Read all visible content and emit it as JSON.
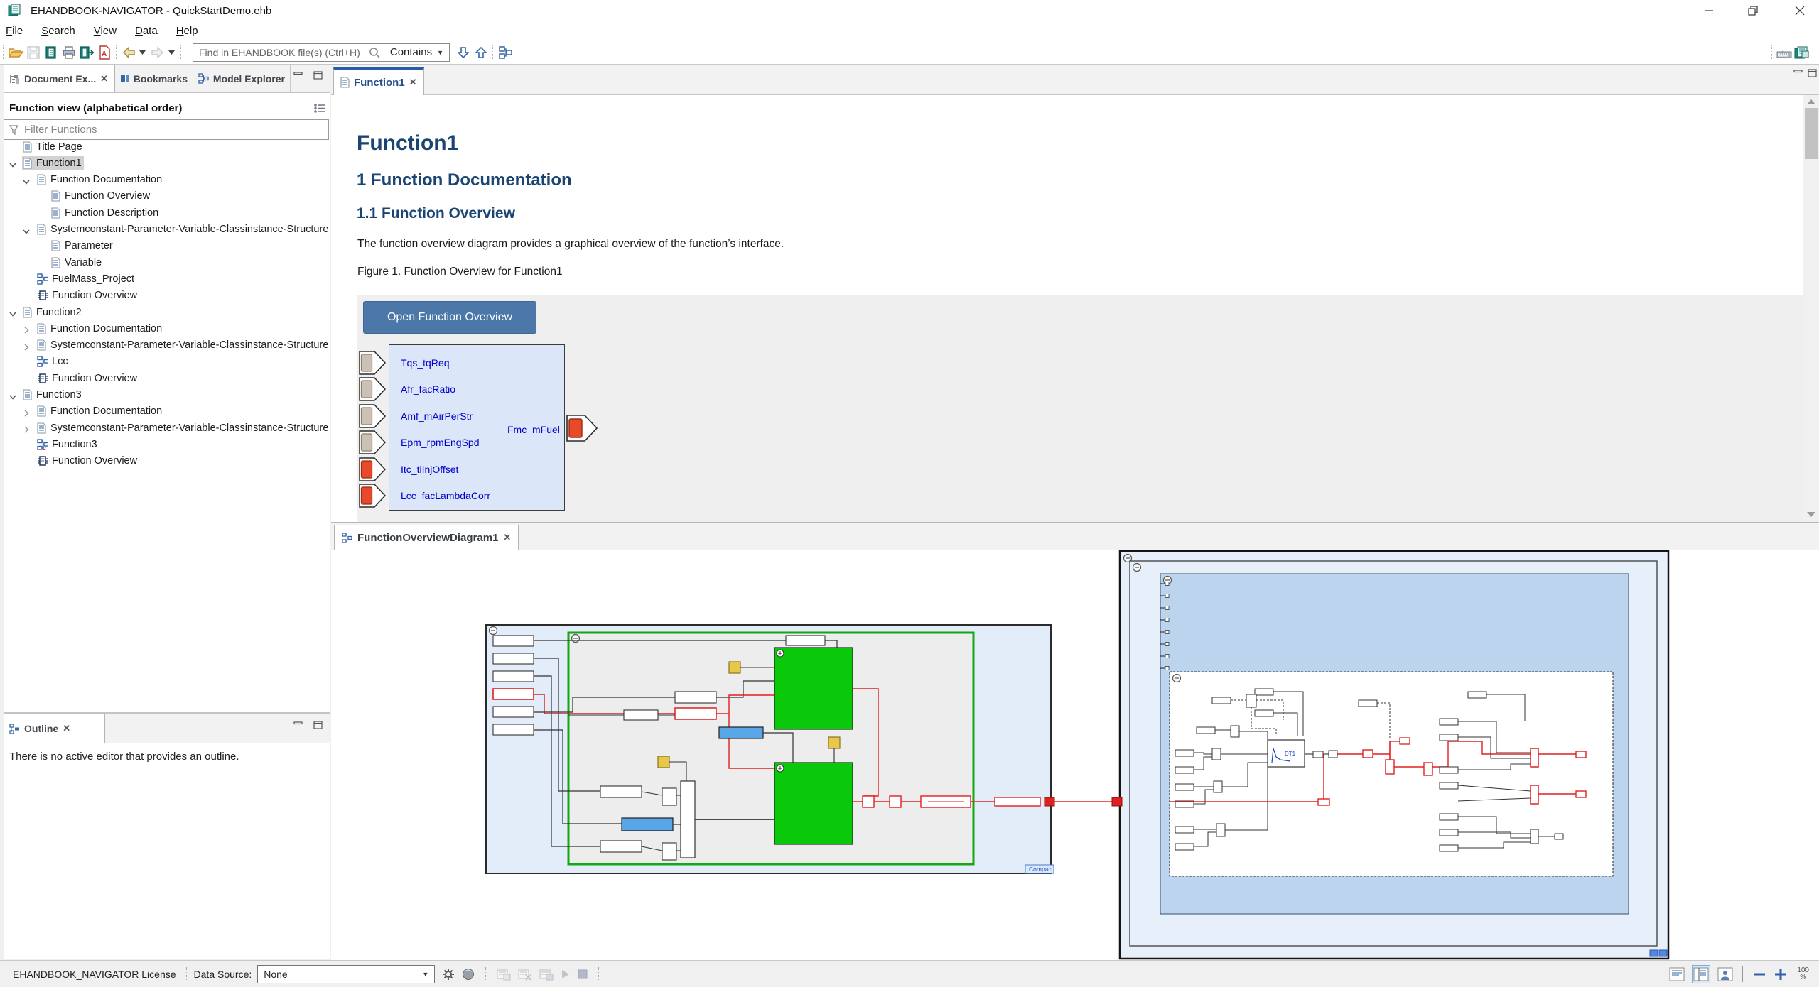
{
  "window": {
    "title": "EHANDBOOK-NAVIGATOR - QuickStartDemo.ehb"
  },
  "menu": {
    "items": [
      "File",
      "Search",
      "View",
      "Data",
      "Help"
    ]
  },
  "toolbar": {
    "search_placeholder": "Find in EHANDBOOK file(s) (Ctrl+H)",
    "search_mode": "Contains"
  },
  "left_tabs": {
    "document_explorer": "Document Ex...",
    "bookmarks": "Bookmarks",
    "model_explorer": "Model Explorer"
  },
  "function_view": {
    "header": "Function view (alphabetical order)",
    "filter_placeholder": "Filter Functions",
    "tree": [
      {
        "label": "Title Page",
        "level": 1,
        "icon": "doc",
        "chevron": "none",
        "selected": false
      },
      {
        "label": "Function1",
        "level": 1,
        "icon": "doc",
        "chevron": "open",
        "selected": true
      },
      {
        "label": "Function Documentation",
        "level": 2,
        "icon": "doc",
        "chevron": "open",
        "selected": false
      },
      {
        "label": "Function Overview",
        "level": 3,
        "icon": "doc",
        "chevron": "none",
        "selected": false
      },
      {
        "label": "Function Description",
        "level": 3,
        "icon": "doc",
        "chevron": "none",
        "selected": false
      },
      {
        "label": "Systemconstant-Parameter-Variable-Classinstance-Structure",
        "level": 2,
        "icon": "doc",
        "chevron": "open",
        "selected": false
      },
      {
        "label": "Parameter",
        "level": 3,
        "icon": "doc",
        "chevron": "none",
        "selected": false
      },
      {
        "label": "Variable",
        "level": 3,
        "icon": "doc",
        "chevron": "none",
        "selected": false
      },
      {
        "label": "FuelMass_Project",
        "level": 2,
        "icon": "model",
        "chevron": "none",
        "selected": false
      },
      {
        "label": "Function Overview",
        "level": 2,
        "icon": "chip",
        "chevron": "none",
        "selected": false
      },
      {
        "label": "Function2",
        "level": 1,
        "icon": "doc",
        "chevron": "open",
        "selected": false
      },
      {
        "label": "Function Documentation",
        "level": 2,
        "icon": "doc",
        "chevron": "closed",
        "selected": false
      },
      {
        "label": "Systemconstant-Parameter-Variable-Classinstance-Structure",
        "level": 2,
        "icon": "doc",
        "chevron": "closed",
        "selected": false
      },
      {
        "label": "Lcc",
        "level": 2,
        "icon": "model",
        "chevron": "none",
        "selected": false
      },
      {
        "label": "Function Overview",
        "level": 2,
        "icon": "chip",
        "chevron": "none",
        "selected": false
      },
      {
        "label": "Function3",
        "level": 1,
        "icon": "doc",
        "chevron": "open",
        "selected": false
      },
      {
        "label": "Function Documentation",
        "level": 2,
        "icon": "doc",
        "chevron": "closed",
        "selected": false
      },
      {
        "label": "Systemconstant-Parameter-Variable-Classinstance-Structure",
        "level": 2,
        "icon": "doc",
        "chevron": "closed",
        "selected": false
      },
      {
        "label": "Function3",
        "level": 2,
        "icon": "modelc",
        "chevron": "none",
        "selected": false
      },
      {
        "label": "Function Overview",
        "level": 2,
        "icon": "chip",
        "chevron": "none",
        "selected": false
      }
    ]
  },
  "outline": {
    "tab": "Outline",
    "message": "There is no active editor that provides an outline."
  },
  "editor": {
    "tab": "Function1",
    "h1": "Function1",
    "h2": "1 Function Documentation",
    "h3": "1.1 Function Overview",
    "body": "The function overview diagram provides a graphical overview of the function’s interface.",
    "caption": "Figure 1. Function Overview for Function1",
    "button": "Open Function Overview",
    "output_label": "Fmc_mFuel",
    "inputs": [
      {
        "name": "Tqs_tqReq",
        "kind": "plain"
      },
      {
        "name": "Afr_facRatio",
        "kind": "plain"
      },
      {
        "name": "Amf_mAirPerStr",
        "kind": "plain"
      },
      {
        "name": "Epm_rpmEngSpd",
        "kind": "plain"
      },
      {
        "name": "Itc_tiInjOffset",
        "kind": "red"
      },
      {
        "name": "Lcc_facLambdaCorr",
        "kind": "red"
      }
    ]
  },
  "diagram_panel": {
    "tab": "FunctionOverviewDiagram1",
    "compact_label": "Compact"
  },
  "status": {
    "license": "EHANDBOOK_NAVIGATOR License",
    "data_source_label": "Data Source:",
    "data_source_value": "None",
    "zoom_value": "100",
    "zoom_unit": "%"
  },
  "colors": {
    "accent_blue": "#2a5ba8",
    "heading_blue": "#1a4472",
    "button_blue": "#4b77a9",
    "port_red": "#e8492a",
    "port_tan": "#cdc0b4",
    "green_block": "#0ac80a",
    "wire_red": "#e02020"
  }
}
